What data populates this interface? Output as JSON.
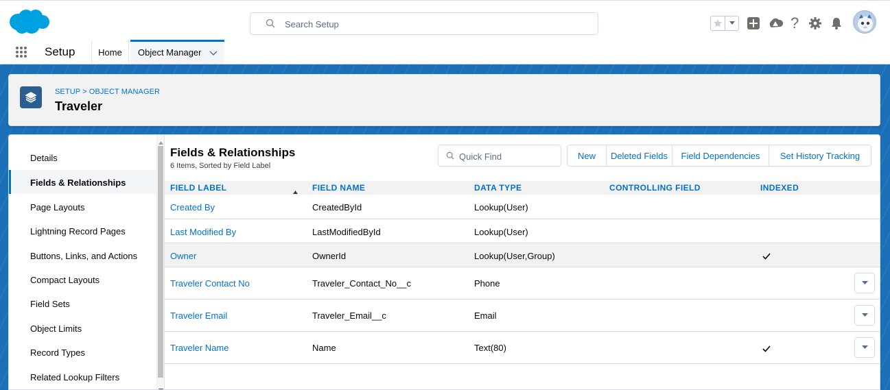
{
  "header": {
    "search_placeholder": "Search Setup"
  },
  "context_bar": {
    "app_name": "Setup",
    "tabs": [
      {
        "label": "Home"
      },
      {
        "label": "Object Manager"
      }
    ]
  },
  "page_header": {
    "breadcrumb": "SETUP > OBJECT MANAGER",
    "title": "Traveler"
  },
  "sidebar": {
    "items": [
      {
        "label": "Details"
      },
      {
        "label": "Fields & Relationships"
      },
      {
        "label": "Page Layouts"
      },
      {
        "label": "Lightning Record Pages"
      },
      {
        "label": "Buttons, Links, and Actions"
      },
      {
        "label": "Compact Layouts"
      },
      {
        "label": "Field Sets"
      },
      {
        "label": "Object Limits"
      },
      {
        "label": "Record Types"
      },
      {
        "label": "Related Lookup Filters"
      }
    ],
    "active_index": 1
  },
  "section": {
    "title": "Fields & Relationships",
    "subtitle": "6 Items, Sorted by Field Label",
    "quick_find_placeholder": "Quick Find",
    "buttons": {
      "new": "New",
      "deleted_fields": "Deleted Fields",
      "field_dependencies": "Field Dependencies",
      "set_history_tracking": "Set History Tracking"
    }
  },
  "table": {
    "columns": [
      "FIELD LABEL",
      "FIELD NAME",
      "DATA TYPE",
      "CONTROLLING FIELD",
      "INDEXED"
    ],
    "sorted_by": "FIELD LABEL",
    "sort_direction": "ascending",
    "rows": [
      {
        "label": "Created By",
        "name": "CreatedById",
        "type": "Lookup(User)",
        "controlling": "",
        "indexed": false
      },
      {
        "label": "Last Modified By",
        "name": "LastModifiedById",
        "type": "Lookup(User)",
        "controlling": "",
        "indexed": false
      },
      {
        "label": "Owner",
        "name": "OwnerId",
        "type": "Lookup(User,Group)",
        "controlling": "",
        "indexed": true
      },
      {
        "label": "Traveler Contact No",
        "name": "Traveler_Contact_No__c",
        "type": "Phone",
        "controlling": "",
        "indexed": false
      },
      {
        "label": "Traveler Email",
        "name": "Traveler_Email__c",
        "type": "Email",
        "controlling": "",
        "indexed": false
      },
      {
        "label": "Traveler Name",
        "name": "Name",
        "type": "Text(80)",
        "controlling": "",
        "indexed": true
      }
    ]
  },
  "colors": {
    "brand_blue": "#0070d2",
    "band_blue": "#1a6fb7",
    "logo_blue": "#00a1e0",
    "object_icon": "#2a5f8f"
  },
  "icons": {
    "logo": "salesforce-cloud-logo",
    "search": "search-icon",
    "favorites": "star-icon",
    "global_actions": "plus-square-icon",
    "trailhead": "trailhead-icon",
    "help": "question-icon",
    "setup": "gear-icon",
    "notifications": "bell-icon",
    "app_launcher": "waffle-icon",
    "object": "layers-icon"
  }
}
